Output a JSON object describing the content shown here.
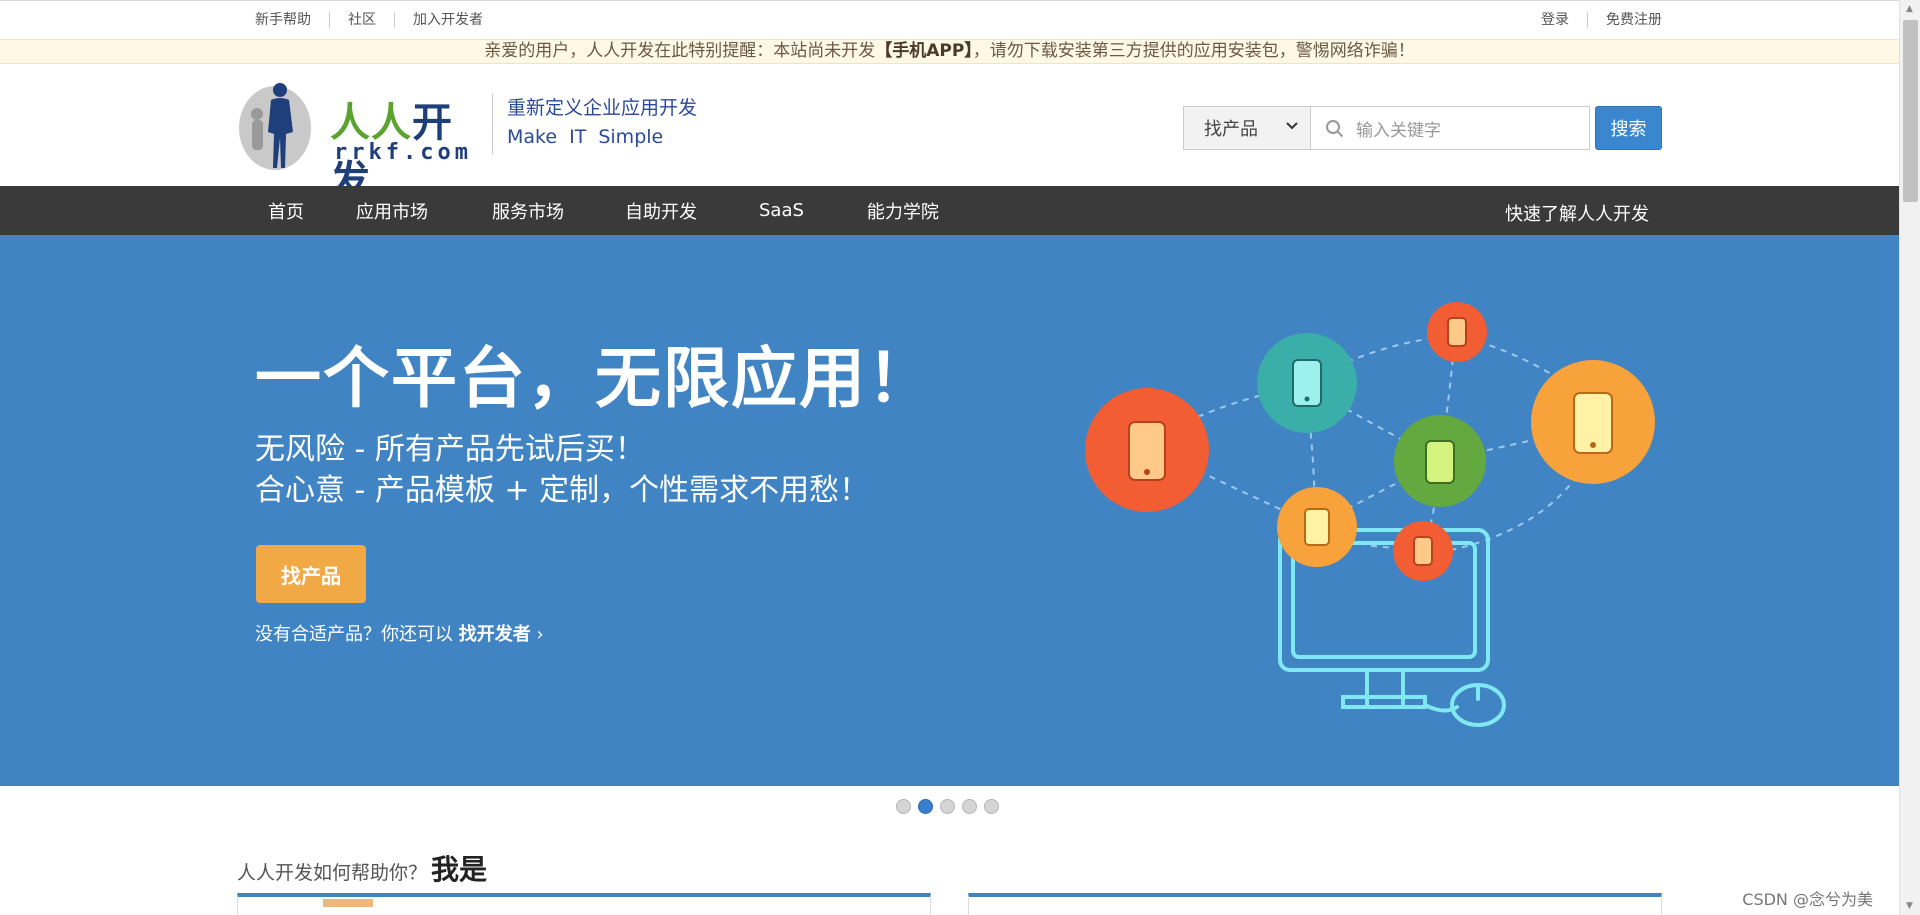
{
  "topbar": {
    "left_links": [
      "新手帮助",
      "社区",
      "加入开发者"
    ],
    "right_links": [
      "登录",
      "免费注册"
    ]
  },
  "notice": {
    "before": "亲爱的用户，人人开发在此特别提醒：本站尚未开发",
    "highlight": "【手机APP】",
    "after": "，请勿下载安装第三方提供的应用安装包，警惕网络诈骗！"
  },
  "header": {
    "logo_cn_green": "人人",
    "logo_cn_blue": "开发",
    "logo_en": "rrkf.com",
    "slogan_line1": "重新定义企业应用开发",
    "slogan_line2": "Make IT Simple",
    "search": {
      "select_value": "找产品",
      "placeholder": "输入关键字",
      "button_label": "搜索"
    }
  },
  "nav": {
    "items": [
      "首页",
      "应用市场",
      "服务市场",
      "自助开发",
      "SaaS",
      "能力学院"
    ],
    "right_link": "快速了解人人开发"
  },
  "banner": {
    "title": "一个平台，无限应用！",
    "line1": "无风险 - 所有产品先试后买！",
    "line2": "合心意 - 产品模板 + 定制，个性需求不用愁！",
    "button_label": "找产品",
    "sub_text": "没有合适产品？你还可以",
    "sub_link": "找开发者",
    "sub_arrow": "›"
  },
  "carousel": {
    "total": 5,
    "active_index": 1
  },
  "section": {
    "title_prefix": "人人开发如何帮助你？",
    "title_bold": "我是"
  },
  "watermark": "CSDN @念兮为美",
  "colors": {
    "accent_blue": "#4184c3",
    "nav_bg": "#3a3a3a",
    "button_orange": "#f0a944",
    "search_button": "#3a87cf",
    "logo_green": "#5aa32e",
    "logo_navy": "#1e3f7a"
  },
  "icons": {
    "search": "search-icon",
    "dropdown": "chevron-down-icon",
    "logo": "person-figure-logo-icon"
  }
}
